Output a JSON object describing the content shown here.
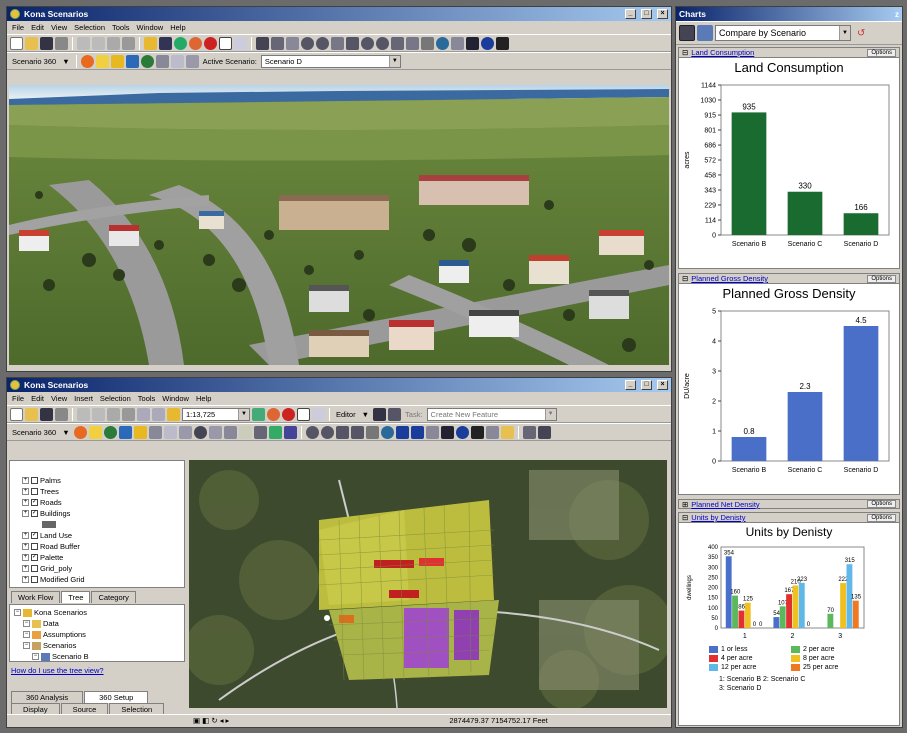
{
  "top_window": {
    "title": "Kona Scenarios",
    "menu": [
      "File",
      "Edit",
      "View",
      "Selection",
      "Tools",
      "Window",
      "Help"
    ],
    "scenario_dropdown": "Scenario 360",
    "active_scenario_label": "Active Scenario:",
    "active_scenario_value": "Scenario D"
  },
  "bottom_window": {
    "title": "Kona Scenarios",
    "menu": [
      "File",
      "Edit",
      "View",
      "Insert",
      "Selection",
      "Tools",
      "Window",
      "Help"
    ],
    "scale": "1:13,725",
    "editor_label": "Editor",
    "task_label": "Task:",
    "task_value": "Create New Feature",
    "scenario_dropdown": "Scenario 360",
    "tree_items": [
      {
        "label": "Palms",
        "checked": false,
        "indent": 1
      },
      {
        "label": "Trees",
        "checked": false,
        "indent": 1
      },
      {
        "label": "Roads",
        "checked": true,
        "indent": 1
      },
      {
        "label": "Buildings",
        "checked": true,
        "indent": 1
      },
      {
        "label": "Land Use",
        "checked": true,
        "indent": 1
      },
      {
        "label": "Road Buffer",
        "checked": false,
        "indent": 1
      },
      {
        "label": "Palette",
        "checked": true,
        "indent": 1
      },
      {
        "label": "Grid_poly",
        "checked": false,
        "indent": 1
      },
      {
        "label": "Modified Grid",
        "checked": false,
        "indent": 1
      }
    ],
    "tabs": [
      "Work Flow",
      "Tree",
      "Category"
    ],
    "tree2_items": [
      {
        "label": "Kona Scenarios",
        "indent": 0
      },
      {
        "label": "Data",
        "indent": 1
      },
      {
        "label": "Assumptions",
        "indent": 1
      },
      {
        "label": "Scenarios",
        "indent": 1
      },
      {
        "label": "Scenario B",
        "indent": 2
      }
    ],
    "help_link": "How do I use the tree view?",
    "bottom_tabs_row1": [
      "360 Analysis",
      "360 Setup"
    ],
    "bottom_tabs_row2": [
      "Display",
      "Source",
      "Selection"
    ],
    "coordinates": "2874479.37  7154752.17 Feet"
  },
  "charts_window": {
    "title": "Charts",
    "compare_dropdown": "Compare by Scenario",
    "options_label": "Options",
    "colors": {
      "green": "#1a6b30",
      "blue": "#4a6fc8"
    }
  },
  "chart_data": [
    {
      "type": "bar",
      "section_label": "Land Consumption",
      "title": "Land Consumption",
      "ylabel": "acres",
      "categories": [
        "Scenario B",
        "Scenario C",
        "Scenario D"
      ],
      "values": [
        935,
        330,
        166
      ],
      "value_labels": [
        "935",
        "330",
        "166"
      ],
      "ylim": [
        0,
        1144
      ],
      "yticks": [
        0,
        114,
        229,
        343,
        458,
        572,
        686,
        801,
        915,
        1030,
        1144
      ],
      "color": "#1a6b30"
    },
    {
      "type": "bar",
      "section_label": "Planned Gross Density",
      "title": "Planned Gross Density",
      "ylabel": "DU/acre",
      "categories": [
        "Scenario B",
        "Scenario C",
        "Scenario D"
      ],
      "values": [
        0.8,
        2.3,
        4.5
      ],
      "value_labels": [
        "0.8",
        "2.3",
        "4.5"
      ],
      "ylim": [
        0,
        5
      ],
      "yticks": [
        0.0,
        1.0,
        2.0,
        3.0,
        4.0,
        5.0
      ],
      "color": "#4a6fc8"
    },
    {
      "type": "bar",
      "section_label": "Units by Denisty",
      "title": "Units by Denisty",
      "ylabel": "dwellings",
      "categories": [
        "1",
        "2",
        "3"
      ],
      "ylim": [
        0,
        400
      ],
      "yticks": [
        0,
        50,
        100,
        150,
        200,
        250,
        300,
        350,
        400
      ],
      "series": [
        {
          "name": "1 or less",
          "color": "#4a6fc8",
          "values": [
            354,
            54,
            0
          ]
        },
        {
          "name": "2 per acre",
          "color": "#5cb85c",
          "values": [
            160,
            107,
            70
          ]
        },
        {
          "name": "4 per acre",
          "color": "#e03030",
          "values": [
            86,
            167,
            0
          ]
        },
        {
          "name": "8 per acre",
          "color": "#f0c020",
          "values": [
            125,
            210,
            222
          ]
        },
        {
          "name": "12 per acre",
          "color": "#60b8e8",
          "values": [
            0,
            223,
            315
          ]
        },
        {
          "name": "25 per acre",
          "color": "#f07820",
          "values": [
            0,
            0,
            135
          ]
        }
      ],
      "value_labels": [
        [
          "354",
          "54",
          ""
        ],
        [
          "160",
          "107",
          "70"
        ],
        [
          "86",
          "167",
          ""
        ],
        [
          "125",
          "210",
          "222"
        ],
        [
          "0",
          "223",
          "315"
        ],
        [
          "0",
          "0",
          "135"
        ]
      ],
      "footnote_1": "1: Scenario B  2: Scenario C",
      "footnote_2": "3: Scenario D"
    }
  ],
  "section_collapsed": "Planned Net Density"
}
